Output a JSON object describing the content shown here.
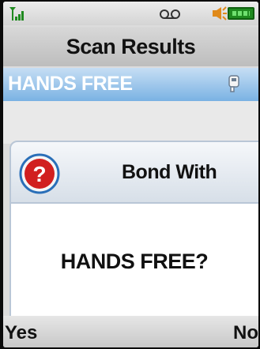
{
  "status_bar": {
    "icons": [
      "signal-strength-icon",
      "voicemail-icon",
      "ringer-icon",
      "battery-icon"
    ],
    "colors": {
      "signal": "#1f8a1f",
      "battery": "#1f8a1f",
      "ringer": "#e08a1a"
    }
  },
  "header": {
    "title": "Scan Results"
  },
  "list": {
    "items": [
      {
        "label": "HANDS FREE",
        "icon": "handsfree-device-icon",
        "selected": true
      }
    ],
    "highlight_color": "#7ab2e3"
  },
  "dialog": {
    "icon": "question-icon",
    "title": "Bond With",
    "message": "HANDS FREE?",
    "icon_color": "#d11f1f"
  },
  "softkeys": {
    "left": "Yes",
    "right": "No"
  }
}
